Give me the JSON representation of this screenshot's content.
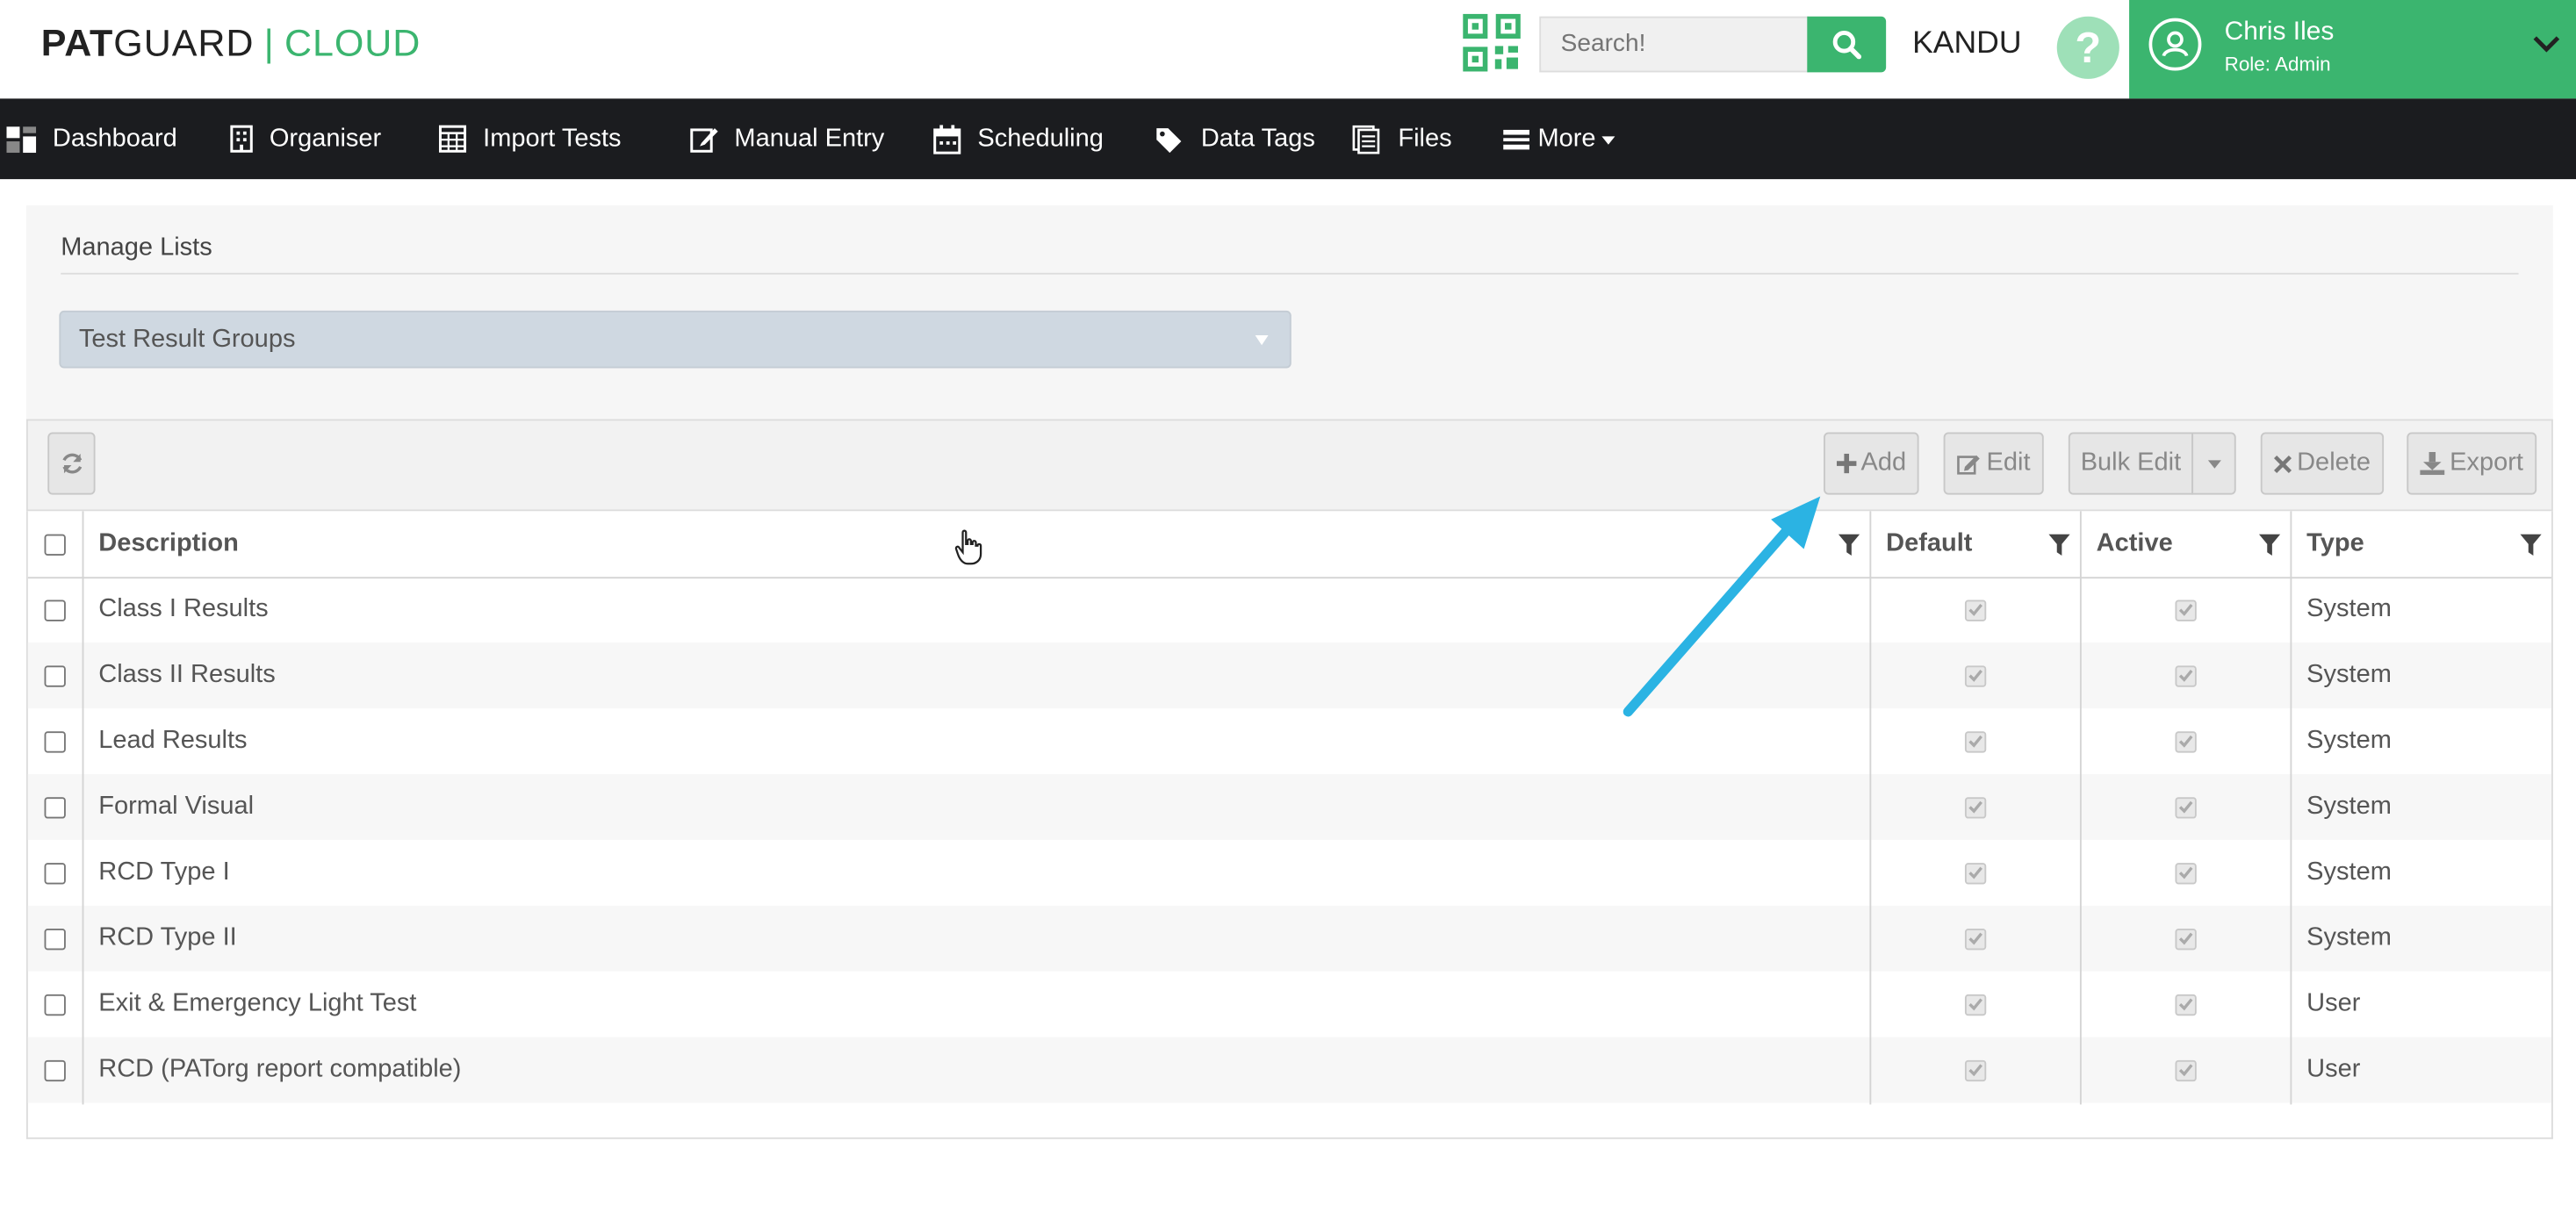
{
  "header": {
    "logo_part1": "PAT",
    "logo_part2": "GUARD",
    "logo_separator": "|",
    "logo_part3": "CLOUD",
    "qr_icon": "qr-code-icon",
    "search_placeholder": "Search!",
    "search_value": "",
    "company": "KANDU",
    "help_label": "?",
    "user_name": "Chris Iles",
    "user_role": "Role: Admin",
    "brand_color": "#3bb56f"
  },
  "nav": {
    "items": [
      {
        "label": "Dashboard",
        "icon": "dashboard-icon"
      },
      {
        "label": "Organiser",
        "icon": "building-icon"
      },
      {
        "label": "Import Tests",
        "icon": "calculator-icon"
      },
      {
        "label": "Manual Entry",
        "icon": "edit-icon"
      },
      {
        "label": "Scheduling",
        "icon": "calendar-icon"
      },
      {
        "label": "Data Tags",
        "icon": "tags-icon"
      },
      {
        "label": "Files",
        "icon": "files-icon"
      },
      {
        "label": "More",
        "icon": "list-icon"
      }
    ]
  },
  "panel": {
    "title": "Manage Lists",
    "select_value": "Test Result Groups"
  },
  "toolbar": {
    "add": "Add",
    "edit": "Edit",
    "bulk_edit": "Bulk Edit",
    "delete": "Delete",
    "export": "Export"
  },
  "grid": {
    "columns": [
      "Description",
      "Default",
      "Active",
      "Type"
    ],
    "rows": [
      {
        "description": "Class I Results",
        "default": true,
        "active": true,
        "type": "System"
      },
      {
        "description": "Class II Results",
        "default": true,
        "active": true,
        "type": "System"
      },
      {
        "description": "Lead Results",
        "default": true,
        "active": true,
        "type": "System"
      },
      {
        "description": "Formal Visual",
        "default": true,
        "active": true,
        "type": "System"
      },
      {
        "description": "RCD Type I",
        "default": true,
        "active": true,
        "type": "System"
      },
      {
        "description": "RCD Type II",
        "default": true,
        "active": true,
        "type": "System"
      },
      {
        "description": "Exit & Emergency Light Test",
        "default": true,
        "active": true,
        "type": "User"
      },
      {
        "description": "RCD (PATorg report compatible)",
        "default": true,
        "active": true,
        "type": "User"
      }
    ]
  },
  "annotation": {
    "arrow_color": "#2bb3e3"
  }
}
